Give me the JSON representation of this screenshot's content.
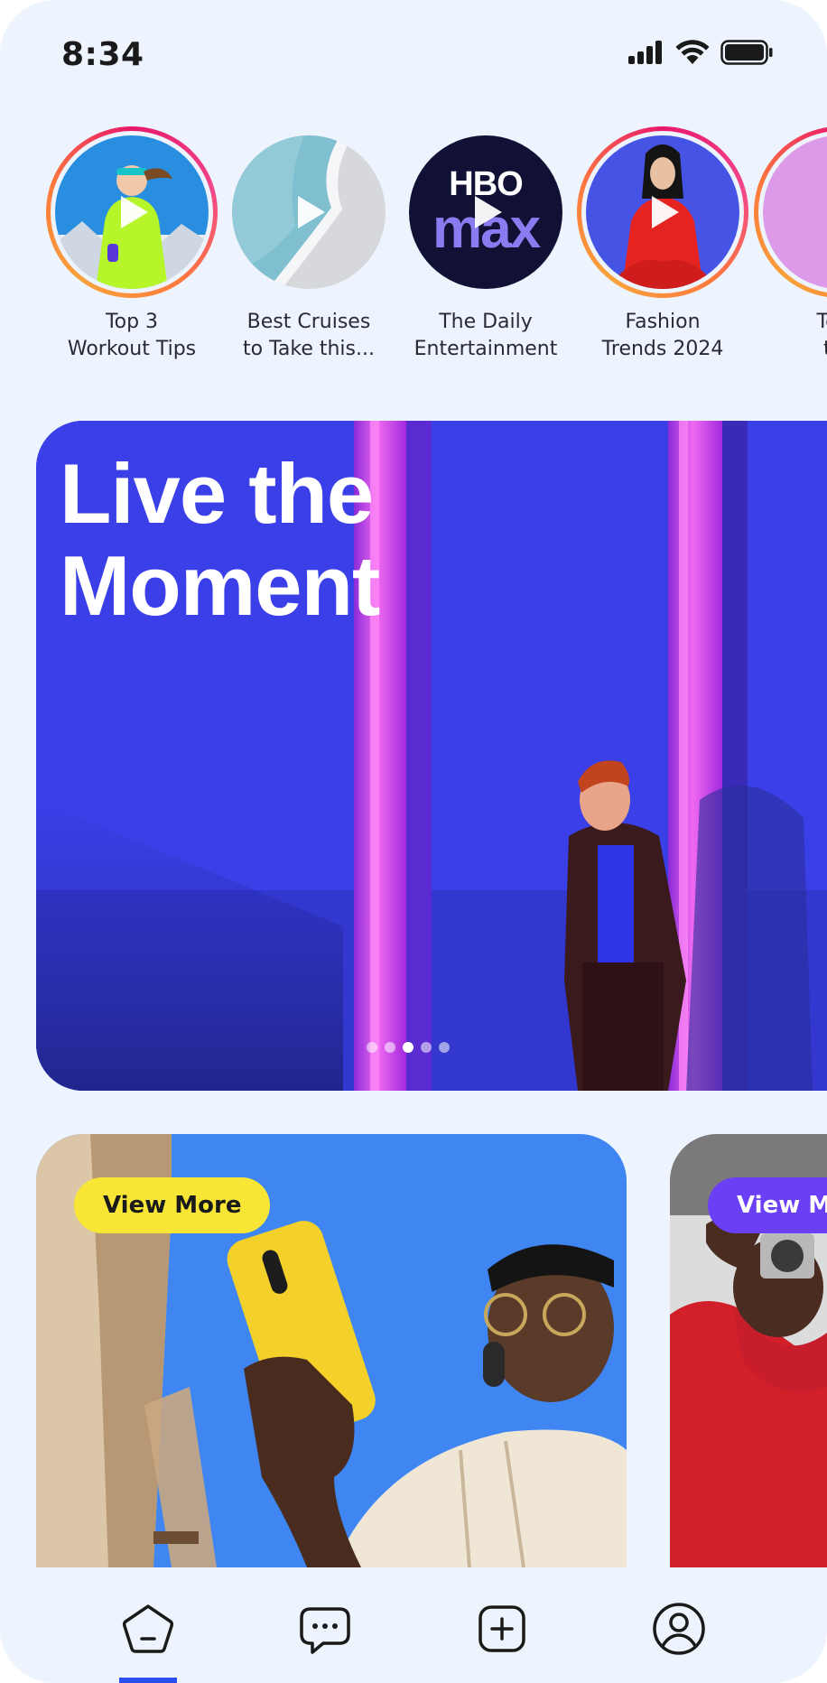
{
  "status_bar": {
    "time": "8:34"
  },
  "stories": [
    {
      "label": "Top 3\nWorkout Tips",
      "active": true
    },
    {
      "label": "Best Cruises\nto Take this...",
      "active": false
    },
    {
      "label": "The Daily\nEntertainment",
      "active": false,
      "logo_lines": [
        "HBO",
        "max"
      ]
    },
    {
      "label": "Fashion\nTrends 2024",
      "active": true
    },
    {
      "label": "Tenn\nthe",
      "active": true
    }
  ],
  "hero": {
    "title": "Live the\nMoment",
    "carousel": {
      "total": 5,
      "current": 3
    }
  },
  "cards": [
    {
      "button_label": "View More"
    },
    {
      "button_label": "View Mo"
    }
  ],
  "bottom_nav": {
    "items": [
      "home-icon",
      "chat-icon",
      "add-icon",
      "profile-icon"
    ],
    "active": "home-icon",
    "accent": "#2b4ef2"
  },
  "colors": {
    "background": "#edf4fd",
    "story_ring": "#e8196a",
    "pill_yellow": "#f7e635",
    "pill_purple": "#6b3ff5",
    "hero_blue": "#3a3fe8",
    "neon_pink": "#e044e8"
  }
}
